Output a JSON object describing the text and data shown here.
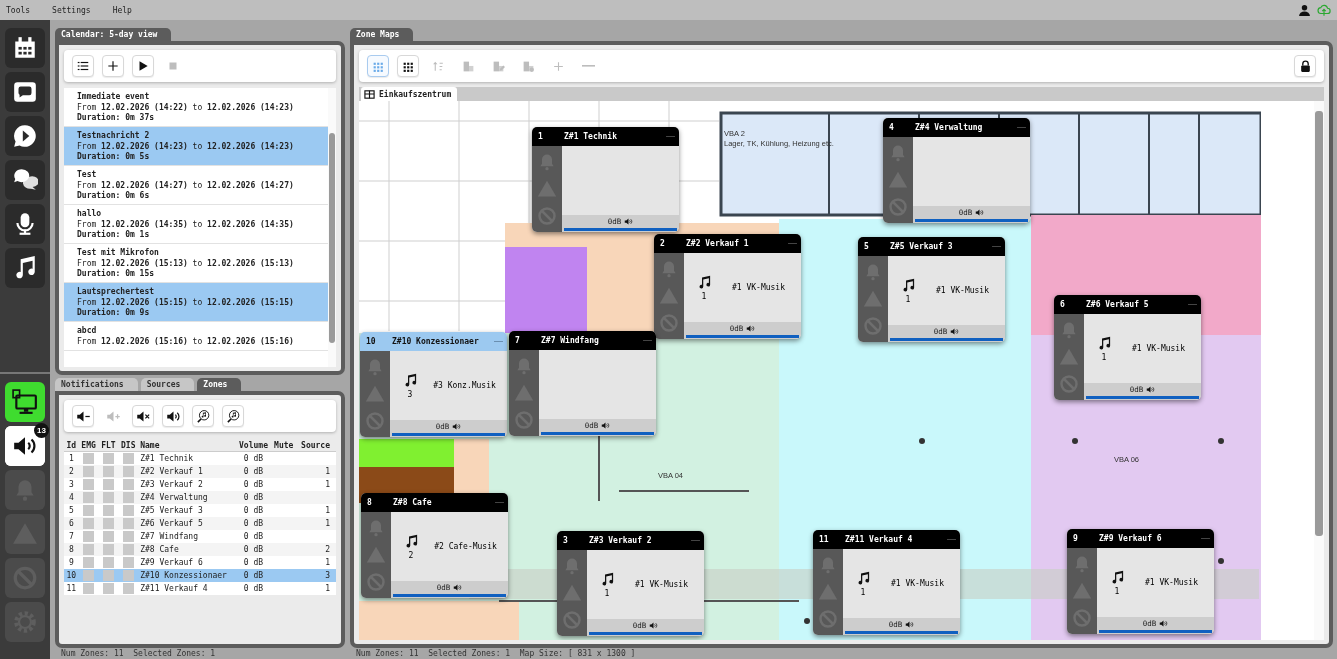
{
  "menu": [
    {
      "label": "Tools"
    },
    {
      "label": "Settings"
    },
    {
      "label": "Help"
    }
  ],
  "nav_top": [
    {
      "kind": "calendar",
      "selected": false
    },
    {
      "kind": "chat",
      "selected": false
    },
    {
      "kind": "play-chat",
      "selected": false
    },
    {
      "kind": "tts",
      "selected": false
    },
    {
      "kind": "microphone",
      "selected": false
    },
    {
      "kind": "music",
      "selected": false
    }
  ],
  "nav_bottom": [
    {
      "kind": "monitor",
      "on": true,
      "selected": false,
      "disabled": false
    },
    {
      "kind": "speaker",
      "on": false,
      "selected": true,
      "disabled": false,
      "badge": "13"
    },
    {
      "kind": "bell",
      "on": false,
      "selected": false,
      "disabled": true
    },
    {
      "kind": "warning",
      "on": false,
      "selected": false,
      "disabled": true
    },
    {
      "kind": "blocked",
      "on": false,
      "selected": false,
      "disabled": true
    },
    {
      "kind": "gear",
      "on": false,
      "selected": false,
      "disabled": true
    }
  ],
  "calendar": {
    "tab": "Calendar: 5-day view",
    "toolbar": [
      {
        "kind": "list",
        "disabled": false
      },
      {
        "kind": "add",
        "disabled": false
      },
      {
        "kind": "play",
        "disabled": false
      },
      {
        "kind": "stop",
        "disabled": true
      }
    ],
    "events": [
      {
        "title": "Immediate event",
        "range": "From **12.02.2026 (14:22)** to **12.02.2026 (14:23)**",
        "duration": "Duration: 0m 37s",
        "selected": false
      },
      {
        "title": "Testnachricht 2",
        "range": "From **12.02.2026 (14:23)** to **12.02.2026 (14:23)**",
        "duration": "Duration: 0m 5s",
        "selected": true
      },
      {
        "title": "Test",
        "range": "From **12.02.2026 (14:27)** to **12.02.2026 (14:27)**",
        "duration": "Duration: 0m 6s",
        "selected": false
      },
      {
        "title": "hallo",
        "range": "From **12.02.2026 (14:35)** to **12.02.2026 (14:35)**",
        "duration": "Duration: 0m 1s",
        "selected": false
      },
      {
        "title": "Test mit Mikrofon",
        "range": "From **12.02.2026 (15:13)** to **12.02.2026 (15:13)**",
        "duration": "Duration: 0m 15s",
        "selected": false
      },
      {
        "title": "Lautsprechertest",
        "range": "From **12.02.2026 (15:15)** to **12.02.2026 (15:15)**",
        "duration": "Duration: 0m 9s",
        "selected": true
      },
      {
        "title": "abcd",
        "range": "From **12.02.2026 (15:16)** to **12.02.2026 (15:16)**",
        "selected": false
      }
    ]
  },
  "zones_panel": {
    "tabs": [
      {
        "label": "Notifications",
        "selected": false
      },
      {
        "label": "Sources",
        "selected": false
      },
      {
        "label": "Zones",
        "selected": true
      }
    ],
    "toolbar": [
      {
        "kind": "volume-down",
        "disabled": false
      },
      {
        "kind": "volume-up",
        "disabled": true
      },
      {
        "kind": "mute",
        "disabled": false
      },
      {
        "kind": "volume",
        "disabled": false
      },
      {
        "kind": "music-search",
        "disabled": false
      },
      {
        "kind": "music-search",
        "disabled": false
      }
    ],
    "columns": [
      "Id",
      "EMG",
      "FLT",
      "DIS",
      "Name",
      "Volume",
      "Mute",
      "Source"
    ],
    "rows": [
      {
        "id": "1",
        "name": "Z#1 Technik",
        "volume": "0 dB",
        "selected": false
      },
      {
        "id": "2",
        "name": "Z#2 Verkauf 1",
        "volume": "0 dB",
        "source": "1",
        "selected": false
      },
      {
        "id": "3",
        "name": "Z#3 Verkauf 2",
        "volume": "0 dB",
        "source": "1",
        "selected": false
      },
      {
        "id": "4",
        "name": "Z#4 Verwaltung",
        "volume": "0 dB",
        "selected": false
      },
      {
        "id": "5",
        "name": "Z#5 Verkauf 3",
        "volume": "0 dB",
        "source": "1",
        "selected": false
      },
      {
        "id": "6",
        "name": "Z#6 Verkauf 5",
        "volume": "0 dB",
        "source": "1",
        "selected": false
      },
      {
        "id": "7",
        "name": "Z#7 Windfang",
        "volume": "0 dB",
        "selected": false
      },
      {
        "id": "8",
        "name": "Z#8 Cafe",
        "volume": "0 dB",
        "source": "2",
        "selected": false
      },
      {
        "id": "9",
        "name": "Z#9 Verkauf 6",
        "volume": "0 dB",
        "source": "1",
        "selected": false
      },
      {
        "id": "10",
        "name": "Z#10 Konzessionaer",
        "volume": "0 dB",
        "source": "3",
        "selected": true
      },
      {
        "id": "11",
        "name": "Z#11 Verkauf 4",
        "volume": "0 dB",
        "source": "1",
        "selected": false
      }
    ],
    "status": "Num Zones: 11  Selected Zones: 1"
  },
  "zone_maps": {
    "tab": "Zone Maps",
    "toolbar": [
      {
        "kind": "grid-large",
        "selected": true,
        "disabled": false
      },
      {
        "kind": "grid",
        "selected": false,
        "disabled": false
      },
      {
        "kind": "sort",
        "selected": false,
        "disabled": true
      },
      {
        "kind": "building",
        "selected": false,
        "disabled": true
      },
      {
        "kind": "building-edit",
        "selected": false,
        "disabled": true
      },
      {
        "kind": "building-settings",
        "selected": false,
        "disabled": true
      },
      {
        "kind": "zoom-in",
        "selected": false,
        "disabled": true
      },
      {
        "kind": "zoom-out",
        "selected": false,
        "disabled": true
      },
      {
        "kind": "lock",
        "selected": false,
        "disabled": false
      }
    ],
    "map_tabs": [
      {
        "label": "Einkaufszentrum",
        "selected": true
      }
    ],
    "map_labels": [
      "VBA 2",
      "Lager, TK, Kühlung, Heizung etc.",
      "VBA 04",
      "VBA 06"
    ],
    "tiles": [
      {
        "id": "1",
        "name": "Z#1 Technik",
        "volume": "0dB",
        "level": 1,
        "selected": false
      },
      {
        "id": "4",
        "name": "Z#4 Verwaltung",
        "volume": "0dB",
        "level": 1,
        "selected": false
      },
      {
        "id": "2",
        "name": "Z#2 Verkauf 1",
        "source": {
          "number": "1",
          "name": "#1 VK-Musik"
        },
        "volume": "0dB",
        "level": 1,
        "selected": false
      },
      {
        "id": "5",
        "name": "Z#5 Verkauf 3",
        "source": {
          "number": "1",
          "name": "#1 VK-Musik"
        },
        "volume": "0dB",
        "level": 1,
        "selected": false
      },
      {
        "id": "6",
        "name": "Z#6 Verkauf 5",
        "source": {
          "number": "1",
          "name": "#1 VK-Musik"
        },
        "volume": "0dB",
        "level": 1,
        "selected": false
      },
      {
        "id": "10",
        "name": "Z#10 Konzessionaer",
        "source": {
          "number": "3",
          "name": "#3 Konz.Musik"
        },
        "volume": "0dB",
        "level": 1,
        "selected": true
      },
      {
        "id": "7",
        "name": "Z#7 Windfang",
        "volume": "0dB",
        "level": 1,
        "selected": false
      },
      {
        "id": "8",
        "name": "Z#8 Cafe",
        "source": {
          "number": "2",
          "name": "#2 Cafe-Musik"
        },
        "volume": "0dB",
        "level": 1,
        "selected": false
      },
      {
        "id": "3",
        "name": "Z#3 Verkauf 2",
        "source": {
          "number": "1",
          "name": "#1 VK-Musik"
        },
        "volume": "0dB",
        "level": 1,
        "selected": false
      },
      {
        "id": "11",
        "name": "Z#11 Verkauf 4",
        "source": {
          "number": "1",
          "name": "#1 VK-Musik"
        },
        "volume": "0dB",
        "level": 1,
        "selected": false
      },
      {
        "id": "9",
        "name": "Z#9 Verkauf 6",
        "source": {
          "number": "1",
          "name": "#1 VK-Musik"
        },
        "volume": "0dB",
        "level": 1,
        "selected": false
      }
    ],
    "status": "Num Zones: 11  Selected Zones: 1  Map Size: [ 831 x 1300 ]"
  }
}
